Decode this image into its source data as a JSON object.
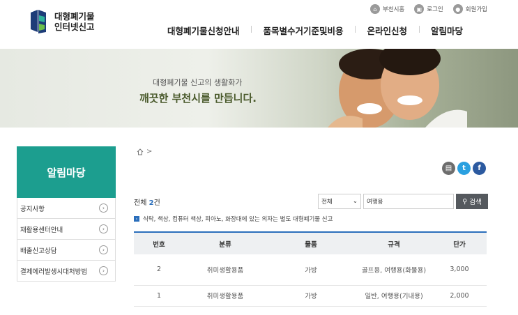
{
  "header": {
    "logo_line1": "대형폐기물",
    "logo_line2": "인터넷신고",
    "util": [
      "부천시홈",
      "로그인",
      "회원가입"
    ],
    "gnb": [
      "대형폐기물신청안내",
      "품목별수거기준및비용",
      "온라인신청",
      "알림마당"
    ]
  },
  "banner": {
    "copy1": "대형폐기물 신고의 생활화가",
    "copy2": "깨끗한 부천시를 만듭니다."
  },
  "lnb": {
    "title": "알림마당",
    "items": [
      "공지사항",
      "재활용센터안내",
      "배출신고상담",
      "결제에러발생시대처방법"
    ]
  },
  "content": {
    "breadcrumb_sep": ">",
    "total_label": "전체",
    "total_count": "2",
    "total_unit": "건",
    "search": {
      "select_value": "전체",
      "keyword": "여행용",
      "button": "검색"
    },
    "notice": "식탁, 책상, 컴퓨터 책상, 피아노, 화장대에 있는 의자는 별도 대형폐기물 신고",
    "table": {
      "headers": [
        "번호",
        "분류",
        "물품",
        "규격",
        "단가"
      ],
      "rows": [
        [
          "2",
          "취미생활용품",
          "가방",
          "골프용, 여행용(화물용)",
          "3,000"
        ],
        [
          "1",
          "취미생활용품",
          "가방",
          "일반, 여행용(기내용)",
          "2,000"
        ]
      ]
    }
  },
  "colors": {
    "brand": "#1c9e8f",
    "accent": "#2a6ebb"
  }
}
